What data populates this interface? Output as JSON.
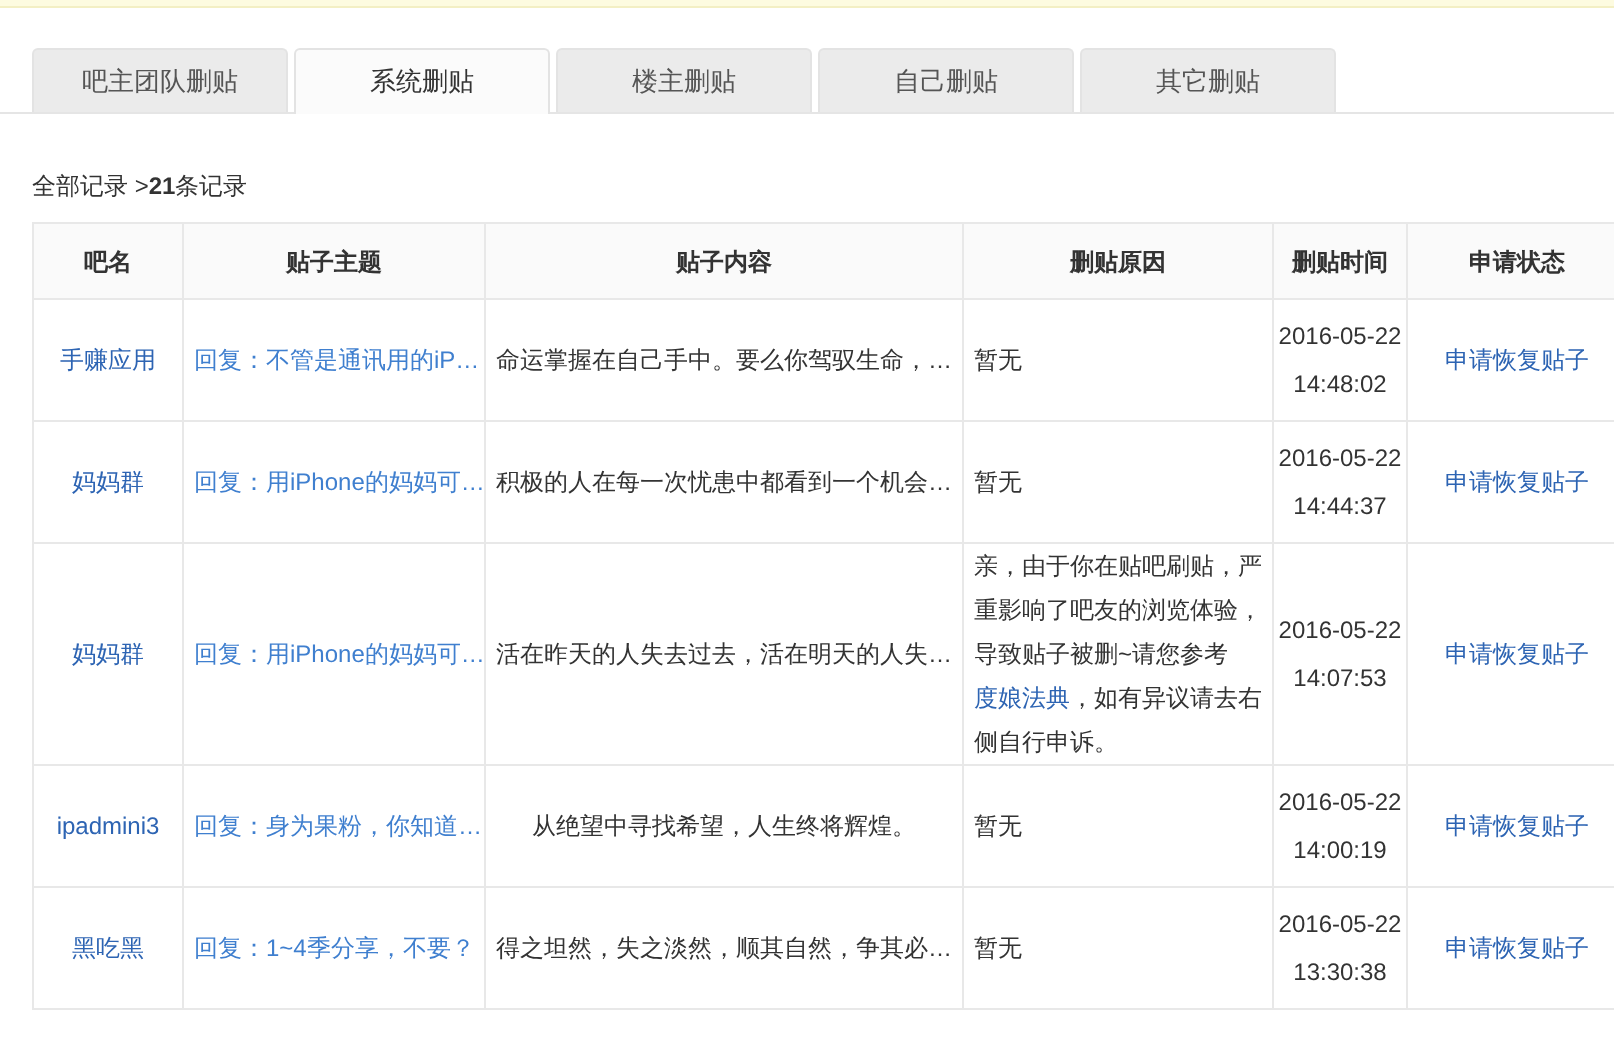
{
  "tabs": [
    {
      "label": "吧主团队删贴",
      "selected": false
    },
    {
      "label": "系统删贴",
      "selected": true
    },
    {
      "label": "楼主删贴",
      "selected": false
    },
    {
      "label": "自己删贴",
      "selected": false
    },
    {
      "label": "其它删贴",
      "selected": false
    }
  ],
  "breadcrumb": {
    "prefix": "全部记录 >",
    "count": "21",
    "suffix": "条记录"
  },
  "table": {
    "columns": [
      "吧名",
      "贴子主题",
      "贴子内容",
      "删贴原因",
      "删贴时间",
      "申请状态"
    ],
    "rows": [
      {
        "forum": "手赚应用",
        "topic": "回复：不管是通讯用的iP…",
        "content": "命运掌握在自己手中。要么你驾驭生命，…",
        "reason": [
          {
            "kind": "text",
            "text": "暂无"
          }
        ],
        "time": "2016-05-22 14:48:02",
        "action": "申请恢复贴子"
      },
      {
        "forum": "妈妈群",
        "topic": "回复：用iPhone的妈妈可…",
        "content": "积极的人在每一次忧患中都看到一个机会…",
        "reason": [
          {
            "kind": "text",
            "text": "暂无"
          }
        ],
        "time": "2016-05-22 14:44:37",
        "action": "申请恢复贴子"
      },
      {
        "forum": "妈妈群",
        "topic": "回复：用iPhone的妈妈可…",
        "content": "活在昨天的人失去过去，活在明天的人失…",
        "reason": [
          {
            "kind": "text",
            "text": "亲，由于你在贴吧刷贴，严重影响了吧友的浏览体验，导致贴子被删~请您参考"
          },
          {
            "kind": "link",
            "text": "度娘法典"
          },
          {
            "kind": "text",
            "text": "，如有异议请去右侧自行申诉。"
          }
        ],
        "time": "2016-05-22 14:07:53",
        "action": "申请恢复贴子"
      },
      {
        "forum": "ipadmini3",
        "topic": "回复：身为果粉，你知道…",
        "content": "从绝望中寻找希望，人生终将辉煌。",
        "reason": [
          {
            "kind": "text",
            "text": "暂无"
          }
        ],
        "time": "2016-05-22 14:00:19",
        "action": "申请恢复贴子"
      },
      {
        "forum": "黑吃黑",
        "topic": "回复：1~4季分享，不要？",
        "content": "得之坦然，失之淡然，顺其自然，争其必…",
        "reason": [
          {
            "kind": "text",
            "text": "暂无"
          }
        ],
        "time": "2016-05-22 13:30:38",
        "action": "申请恢复贴子"
      }
    ]
  }
}
